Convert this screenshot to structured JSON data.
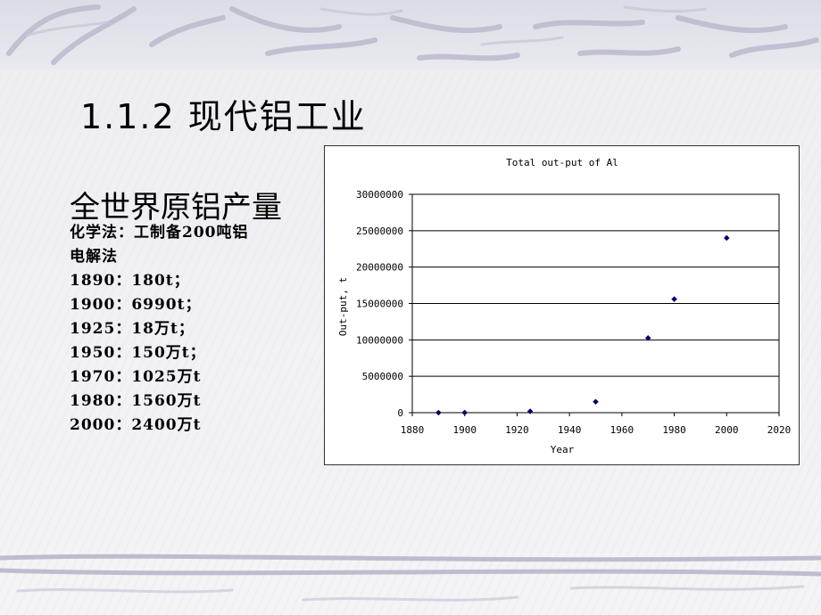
{
  "slide": {
    "title": "1.1.2 现代铝工业",
    "subtitle": "全世界原铝产量",
    "lines": [
      "化学法：工制备200吨铝",
      "电解法",
      "1890：180t；",
      "1900：6990t；",
      "1925：18万t；",
      "1950：150万t；",
      "1970：1025万t",
      "1980：1560万t",
      "2000：2400万t"
    ]
  },
  "colors": {
    "marker": "#000066",
    "grid": "#000000",
    "text": "#000000"
  },
  "chart_data": {
    "type": "scatter",
    "title": "Total out-put of Al",
    "xlabel": "Year",
    "ylabel": "Out-put, t",
    "xlim": [
      1880,
      2020
    ],
    "ylim": [
      0,
      30000000
    ],
    "x_ticks": [
      "1880",
      "1900",
      "1920",
      "1940",
      "1960",
      "1980",
      "2000",
      "2020"
    ],
    "y_ticks": [
      "0",
      "5000000",
      "10000000",
      "15000000",
      "20000000",
      "25000000",
      "30000000"
    ],
    "grid": "horizontal",
    "legend": "none",
    "series": [
      {
        "x": [
          1890,
          1900,
          1925,
          1950,
          1970,
          1980,
          2000
        ],
        "y": [
          180,
          6990,
          180000,
          1500000,
          10250000,
          15600000,
          24000000
        ]
      }
    ]
  }
}
